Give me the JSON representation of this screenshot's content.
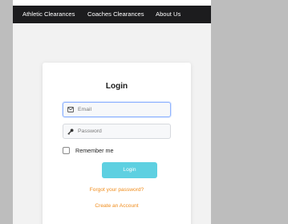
{
  "nav": {
    "links": [
      "Athletic Clearances",
      "Coaches Clearances",
      "About Us"
    ]
  },
  "login": {
    "title": "Login",
    "email_placeholder": "Email",
    "password_placeholder": "Password",
    "remember_label": "Remember me",
    "submit_label": "Login",
    "forgot_link": "Forgot your password?",
    "create_link": "Create an Account"
  },
  "colors": {
    "navbar": "#1c1c1e",
    "button": "#5ed0e1",
    "link": "#f08c1b"
  },
  "icons": {
    "email": "envelope-icon",
    "password": "key-icon"
  }
}
